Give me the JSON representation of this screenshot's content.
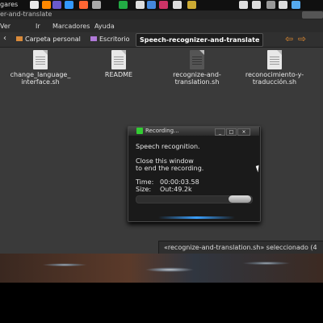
{
  "top_panel": {
    "places_label": "gares",
    "tray_colors": [
      "#e8e8e8",
      "#ff8800",
      "#6a5acd",
      "#3399ff",
      "#ff6633",
      "#aaaaaa",
      "#22aa44",
      "#dddddd",
      "#4488dd",
      "#cc3366",
      "#dddddd",
      "#ccaa33",
      "#dddddd",
      "#dddddd",
      "#999999",
      "#dddddd",
      "#55aaee"
    ]
  },
  "window": {
    "title": "er-and-translate"
  },
  "menubar": {
    "items": [
      "Ver",
      "Ir",
      "Marcadores",
      "Ayuda"
    ]
  },
  "toolbar": {
    "back_icon": "chevron-left-icon",
    "crumbs": [
      "Carpeta personal",
      "Escritorio",
      "Speech-recognizer-and-translate"
    ],
    "nav_icons": [
      "arrow-left-icon",
      "arrow-right-icon"
    ]
  },
  "files": [
    {
      "name": "change_language_\ninterface.sh"
    },
    {
      "name": "README"
    },
    {
      "name": "recognize-and-\ntranslation.sh"
    },
    {
      "name": "reconocimiento-y-\ntraducción.sh"
    }
  ],
  "recording_dialog": {
    "title": "Recording...",
    "min_label": "_",
    "max_label": "□",
    "close_label": "×",
    "line1": "Speech recognition.",
    "line2": "Close this window",
    "line3": "to end the recording.",
    "time_label": "Time:",
    "time_value": "00:00:03.58",
    "size_label": "Size:",
    "size_value": "Out:49.2k"
  },
  "statusbar": {
    "text": "«recognize-and-translation.sh» seleccionado (4"
  }
}
